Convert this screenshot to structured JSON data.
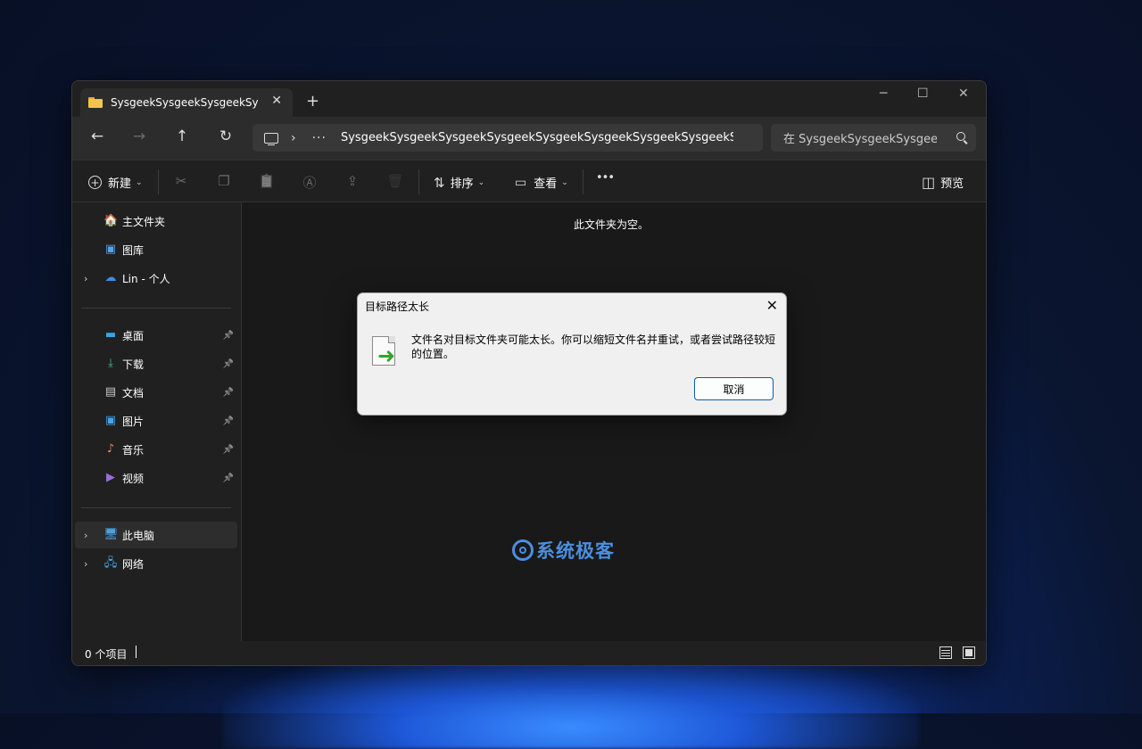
{
  "window": {
    "tab_title": "SysgeekSysgeekSysgeekSysgeek",
    "tab_close": "✕",
    "new_tab": "+",
    "minimize": "─",
    "maximize": "☐",
    "close": "✕"
  },
  "nav": {
    "back": "←",
    "forward": "→",
    "up": "↑",
    "refresh": "↻",
    "chevron": "›",
    "more": "···",
    "address_path": "SysgeekSysgeekSysgeekSysgeekSysgeekSysgeekSysgeekSysgeekSysgeek",
    "search_placeholder": "在 SysgeekSysgeekSysgeekSysgeek"
  },
  "toolbar": {
    "new_label": "新建",
    "cut_icon": "✂",
    "copy_icon": "❐",
    "paste_icon": "📋",
    "rename_icon": "Ⓐ",
    "share_icon": "⇪",
    "delete_icon": "🗑",
    "sort_icon": "⇅",
    "sort_label": "排序",
    "view_icon": "▭",
    "view_label": "查看",
    "more": "•••",
    "preview_icon": "◫",
    "preview_label": "预览",
    "caret": "⌄"
  },
  "sidebar": {
    "top_items": [
      {
        "label": "主文件夹",
        "icon": "🏠",
        "color": "#e8a64a"
      },
      {
        "label": "图库",
        "icon": "▣",
        "color": "#5aa0e8"
      },
      {
        "label": "Lin - 个人",
        "icon": "☁",
        "color": "#3a8ee6",
        "chevron": "›"
      }
    ],
    "pinned_items": [
      {
        "label": "桌面",
        "icon": "▬",
        "color": "#3aa4e6",
        "pin": "📌"
      },
      {
        "label": "下载",
        "icon": "⤓",
        "color": "#3ec48a",
        "pin": "📌"
      },
      {
        "label": "文档",
        "icon": "▤",
        "color": "#c8c8c8",
        "pin": "📌"
      },
      {
        "label": "图片",
        "icon": "▣",
        "color": "#4aa2e0",
        "pin": "📌"
      },
      {
        "label": "音乐",
        "icon": "♪",
        "color": "#e8845a",
        "pin": "📌"
      },
      {
        "label": "视频",
        "icon": "▶",
        "color": "#9a6ae0",
        "pin": "📌"
      }
    ],
    "bottom_items": [
      {
        "label": "此电脑",
        "icon": "🖥",
        "color": "#4aa2e0",
        "chevron": "›"
      },
      {
        "label": "网络",
        "icon": "🖧",
        "color": "#4aa2e0",
        "chevron": "›"
      }
    ]
  },
  "content": {
    "empty_message": "此文件夹为空。"
  },
  "status": {
    "item_count": "0 个项目"
  },
  "dialog": {
    "title": "目标路径太长",
    "close": "✕",
    "message": "文件名对目标文件夹可能太长。你可以缩短文件名并重试，或者尝试路径较短的位置。",
    "arrow": "➜",
    "cancel_label": "取消"
  },
  "watermark": {
    "text": "系统极客"
  }
}
